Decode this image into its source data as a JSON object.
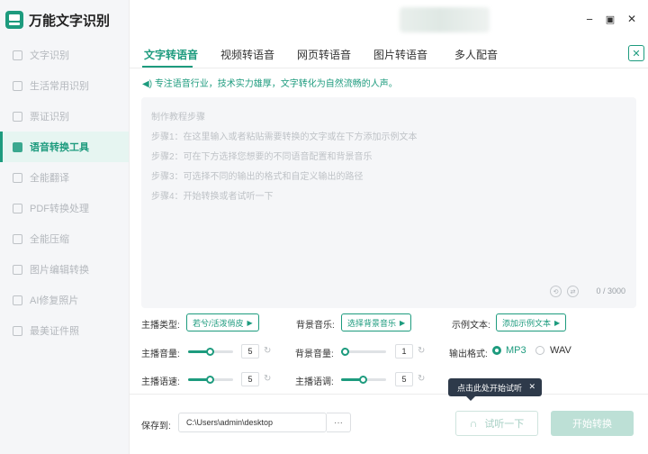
{
  "app": {
    "name": "万能文字识别"
  },
  "sidebar": {
    "items": [
      {
        "label": "文字识别",
        "active": false
      },
      {
        "label": "生活常用识别",
        "active": false
      },
      {
        "label": "票证识别",
        "active": false
      },
      {
        "label": "语音转换工具",
        "active": true
      },
      {
        "label": "全能翻译",
        "active": false
      },
      {
        "label": "PDF转换处理",
        "active": false
      },
      {
        "label": "全能压缩",
        "active": false
      },
      {
        "label": "图片编辑转换",
        "active": false
      },
      {
        "label": "AI修复照片",
        "active": false
      },
      {
        "label": "最美证件照",
        "active": false
      }
    ]
  },
  "window": {
    "minimize": "−",
    "maximize": "▣",
    "close": "✕"
  },
  "tabs": [
    {
      "label": "文字转语音",
      "active": true
    },
    {
      "label": "视频转语音",
      "active": false
    },
    {
      "label": "网页转语音",
      "active": false
    },
    {
      "label": "图片转语音",
      "active": false
    },
    {
      "label": "多人配音",
      "active": false
    }
  ],
  "tip": "专注语音行业，技术实力雄厚，文字转化为自然流畅的人声。",
  "editor": {
    "lines": [
      "制作教程步骤",
      "步骤1：在这里输入或者粘贴需要转换的文字或在下方添加示例文本",
      "步骤2：可在下方选择您想要的不同语音配置和背景音乐",
      "步骤3：可选择不同的输出的格式和自定义输出的路径",
      "步骤4：开始转换或者试听一下"
    ],
    "counter": "0 / 3000"
  },
  "options": {
    "anchor_type_label": "主播类型:",
    "anchor_type_value": "若兮/活泼俏皮",
    "bgm_label": "背景音乐:",
    "bgm_value": "选择背景音乐",
    "sample_label": "示例文本:",
    "sample_value": "添加示例文本",
    "anchor_volume_label": "主播音量:",
    "anchor_volume": "5",
    "bgm_volume_label": "背景音量:",
    "bgm_volume": "1",
    "format_label": "输出格式:",
    "format_mp3": "MP3",
    "format_wav": "WAV",
    "format_selected": "MP3",
    "anchor_speed_label": "主播语速:",
    "anchor_speed": "5",
    "anchor_pitch_label": "主播语调:",
    "anchor_pitch": "5"
  },
  "slider_levels": {
    "anchor_volume": 0.5,
    "bgm_volume": 0.1,
    "anchor_speed": 0.5,
    "anchor_pitch": 0.5
  },
  "bottom": {
    "save_label": "保存到:",
    "save_path": "C:\\Users\\admin\\desktop",
    "browse": "···",
    "listen": "试听一下",
    "start": "开始转换"
  },
  "tooltip": {
    "text": "点击此处开始试听",
    "close": "✕"
  },
  "colors": {
    "accent": "#1d9b7e",
    "tooltip_bg": "#2e3a4a"
  }
}
